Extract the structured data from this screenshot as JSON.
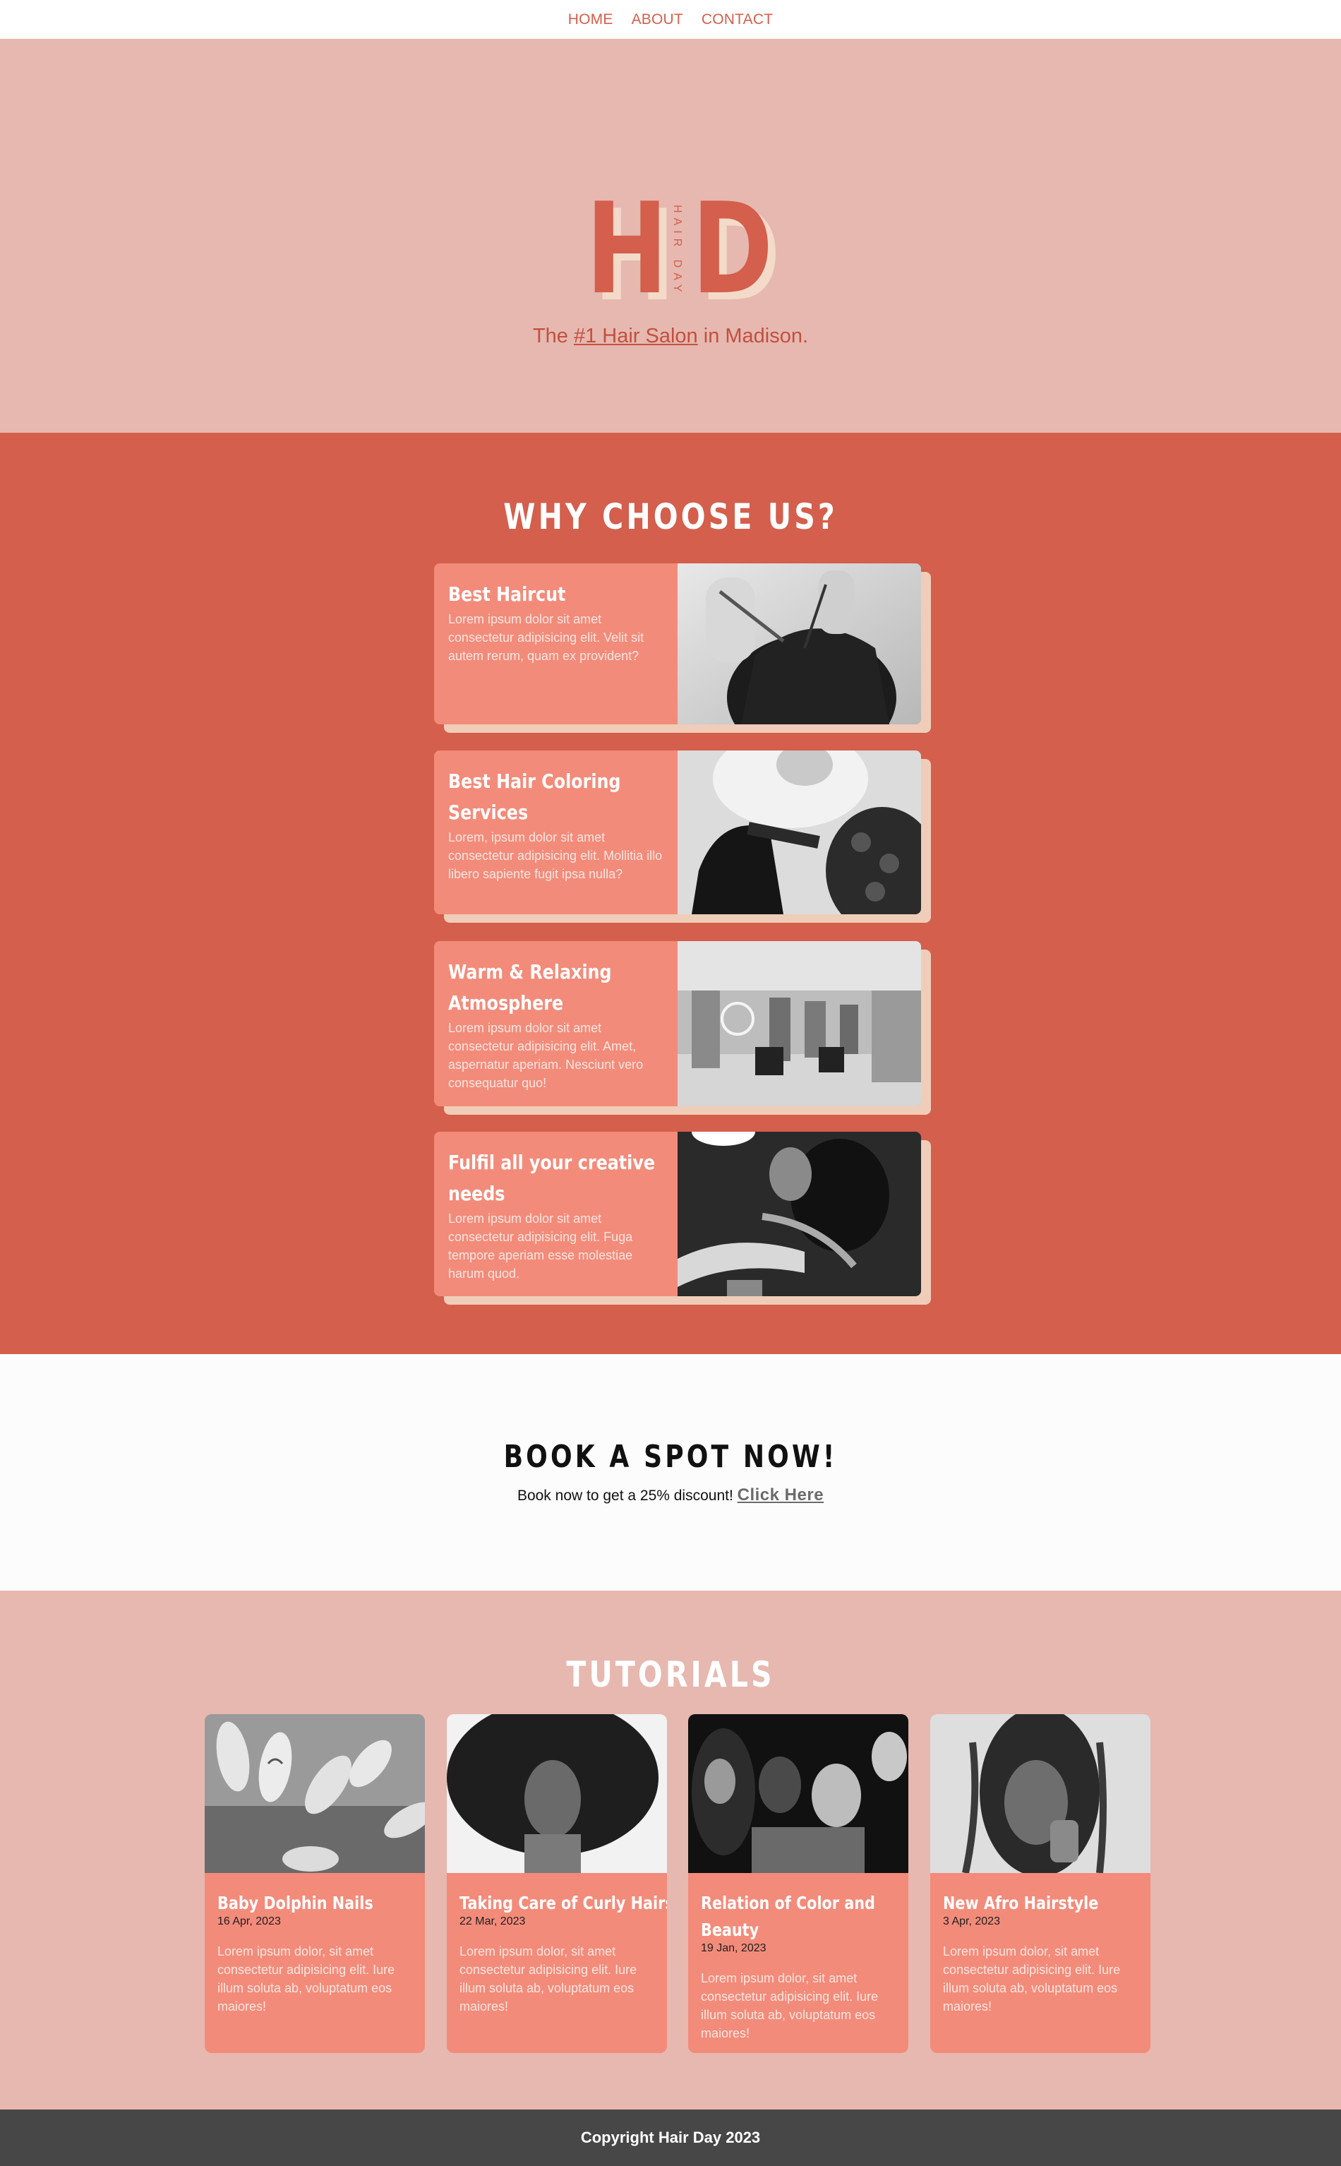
{
  "nav": {
    "items": [
      {
        "label": "HOME"
      },
      {
        "label": "ABOUT"
      },
      {
        "label": "CONTACT"
      }
    ]
  },
  "hero": {
    "logo_letter_1": "H",
    "logo_letter_2": "D",
    "logo_vertical_text": "HAIR DAY",
    "tagline_prefix": "The ",
    "tagline_link": "#1 Hair Salon",
    "tagline_suffix": " in Madison."
  },
  "why": {
    "title": "WHY CHOOSE US?",
    "cards": [
      {
        "title_line1": "Best Haircut",
        "title_line2": "",
        "text": "Lorem ipsum dolor sit amet consectetur adipisicing elit. Velit sit autem rerum, quam ex provident?",
        "image_icon": "haircut-photo"
      },
      {
        "title_line1": "Best Hair Coloring",
        "title_line2": "Services",
        "text": "Lorem, ipsum dolor sit amet consectetur adipisicing elit. Mollitia illo libero sapiente fugit ipsa nulla?",
        "image_icon": "hair-coloring-photo"
      },
      {
        "title_line1": "Warm & Relaxing",
        "title_line2": "Atmosphere",
        "text": "Lorem ipsum dolor sit amet consectetur adipisicing elit. Amet, aspernatur aperiam. Nesciunt vero consequatur quo!",
        "image_icon": "salon-interior-photo"
      },
      {
        "title_line1": "Fulfil all your creative",
        "title_line2": "needs",
        "text": "Lorem ipsum dolor sit amet consectetur adipisicing elit. Fuga tempore aperiam esse molestiae harum quod.",
        "image_icon": "nail-artist-photo"
      }
    ]
  },
  "book": {
    "title": "BOOK A SPOT NOW!",
    "text": "Book now to get a 25% discount! ",
    "link": "Click Here"
  },
  "tutorials": {
    "title": "TUTORIALS",
    "cards": [
      {
        "title_line1": "Baby Dolphin Nails",
        "title_line2": "",
        "date": "16 Apr, 2023",
        "text": "Lorem ipsum dolor, sit amet consectetur adipisicing elit. Iure illum soluta ab, voluptatum eos maiores!",
        "image_icon": "nails-photo"
      },
      {
        "title_line1": "Taking Care of Curly Hairs",
        "title_line2": "",
        "date": "22 Mar, 2023",
        "text": "Lorem ipsum dolor, sit amet consectetur adipisicing elit. Iure illum soluta ab, voluptatum eos maiores!",
        "image_icon": "curly-hair-photo"
      },
      {
        "title_line1": "Relation of Color and",
        "title_line2": "Beauty",
        "date": "19 Jan, 2023",
        "text": "Lorem ipsum dolor, sit amet consectetur adipisicing elit. Iure illum soluta ab, voluptatum eos maiores!",
        "image_icon": "group-portrait-photo"
      },
      {
        "title_line1": "New Afro Hairstyle",
        "title_line2": "",
        "date": "3 Apr, 2023",
        "text": "Lorem ipsum dolor, sit amet consectetur adipisicing elit. Iure illum soluta ab, voluptatum eos maiores!",
        "image_icon": "afro-braids-photo"
      }
    ]
  },
  "footer": {
    "text": "Copyright Hair Day 2023"
  },
  "colors": {
    "accent": "#d35f4c",
    "hero_bg": "#e6b8b0",
    "card_bg": "#f38b7a",
    "card_shadow": "#efcdb8",
    "footer_bg": "#474747"
  }
}
